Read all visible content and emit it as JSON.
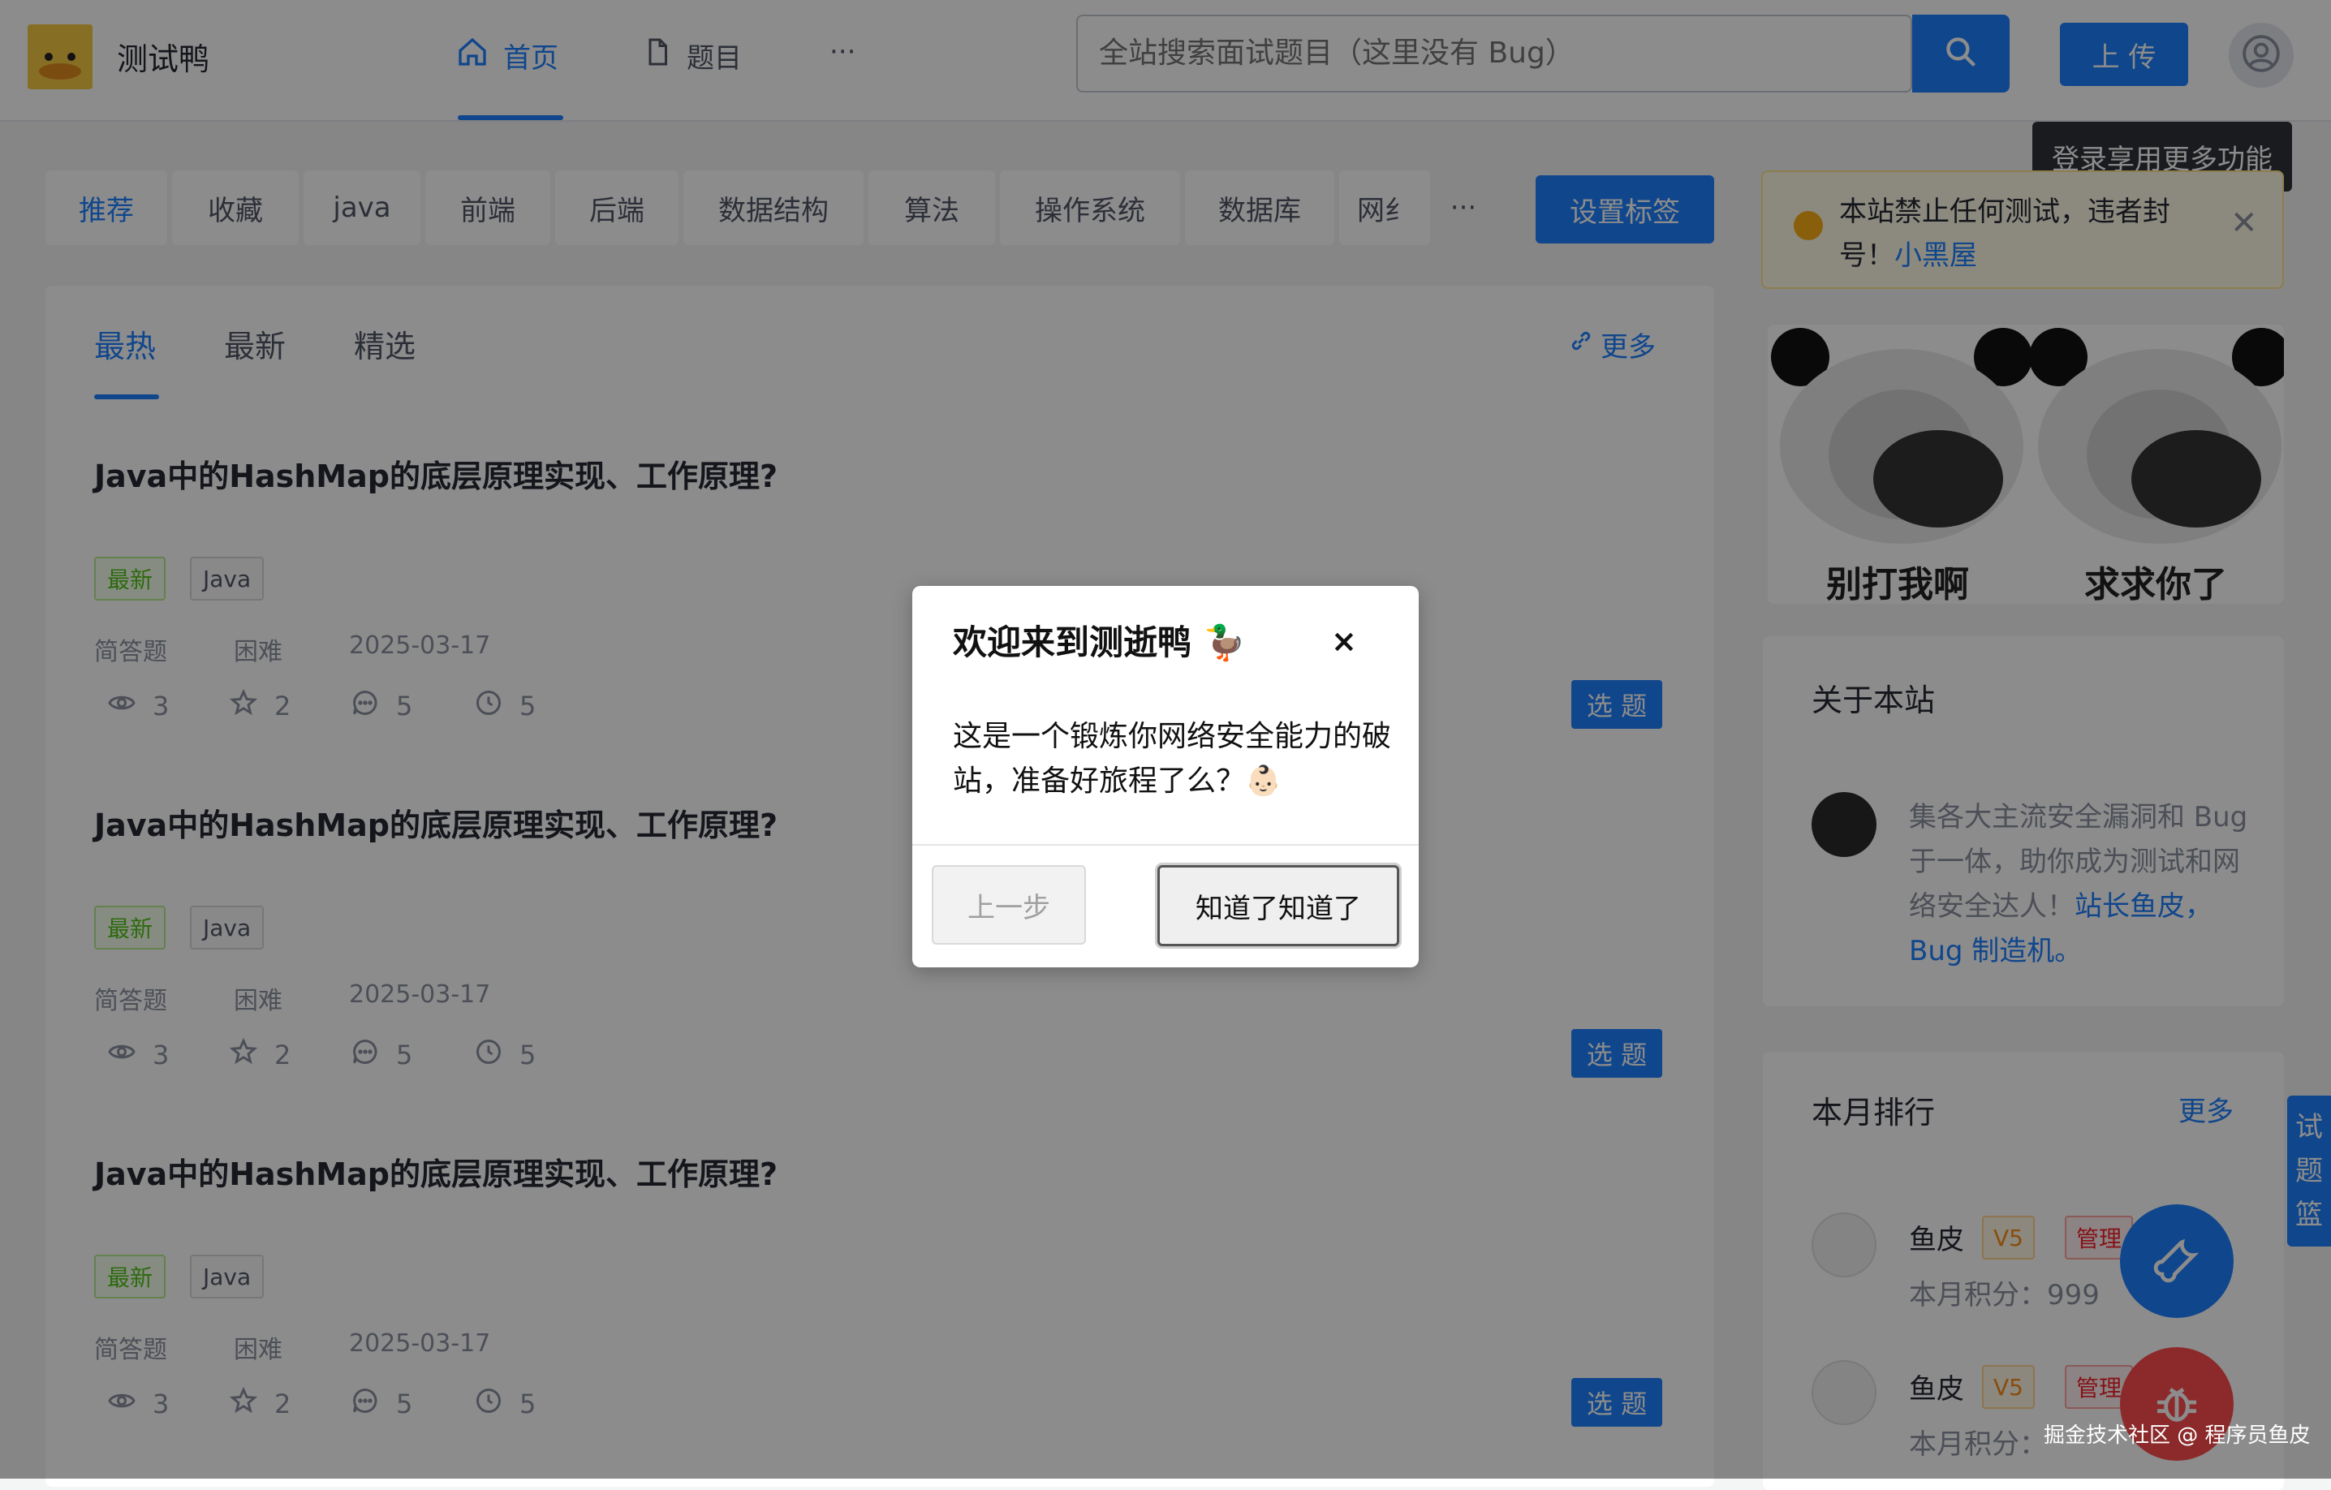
{
  "header": {
    "site_name": "测试鸭",
    "nav": [
      {
        "label": "首页",
        "icon": "home-icon"
      },
      {
        "label": "题目",
        "icon": "document-icon"
      },
      {
        "label": "···",
        "icon": "more-icon"
      }
    ],
    "search_placeholder": "全站搜索面试题目（这里没有 Bug）",
    "upload_label": "上 传",
    "tooltip": "登录享用更多功能"
  },
  "tags": {
    "items": [
      "推荐",
      "收藏",
      "java",
      "前端",
      "后端",
      "数据结构",
      "算法",
      "操作系统",
      "数据库",
      "网纟"
    ],
    "more": "···",
    "set_label": "设置标签"
  },
  "main": {
    "tabs": [
      "最热",
      "最新",
      "精选"
    ],
    "more_label": "更多",
    "questions": [
      {
        "title": "Java中的HashMap的底层原理实现、工作原理?",
        "badges": [
          "最新",
          "Java"
        ],
        "type": "简答题",
        "difficulty": "困难",
        "date": "2025-03-17",
        "views": "3",
        "stars": "2",
        "comments": "5",
        "time": "5",
        "pick": "选 题"
      },
      {
        "title": "Java中的HashMap的底层原理实现、工作原理?",
        "badges": [
          "最新",
          "Java"
        ],
        "type": "简答题",
        "difficulty": "困难",
        "date": "2025-03-17",
        "views": "3",
        "stars": "2",
        "comments": "5",
        "time": "5",
        "pick": "选 题"
      },
      {
        "title": "Java中的HashMap的底层原理实现、工作原理?",
        "badges": [
          "最新",
          "Java"
        ],
        "type": "简答题",
        "difficulty": "困难",
        "date": "2025-03-17",
        "views": "3",
        "stars": "2",
        "comments": "5",
        "time": "5",
        "pick": "选 题"
      }
    ]
  },
  "side": {
    "notice_text": "本站禁止任何测试，违者封号！",
    "notice_link": "小黑屋",
    "meme_left": "别打我啊",
    "meme_right": "求求你了",
    "about_title": "关于本站",
    "about_text": "集各大主流安全漏洞和 Bug 于一体，助你成为测试和网络安全达人！",
    "about_link": "站长鱼皮，Bug 制造机。",
    "rank_title": "本月排行",
    "rank_more": "更多",
    "ranks": [
      {
        "name": "鱼皮",
        "level": "V5",
        "role": "管理",
        "score": "本月积分：999"
      },
      {
        "name": "鱼皮",
        "level": "V5",
        "role": "管理",
        "score": "本月积分："
      }
    ],
    "side_tab": [
      "试",
      "题",
      "篮"
    ]
  },
  "modal": {
    "title": "欢迎来到测逝鸭 🦆",
    "close": "×",
    "body": "这是一个锻炼你网络安全能力的破站，准备好旅程了么？👶🏻",
    "prev_label": "上一步",
    "ok_label": "知道了知道了"
  },
  "watermark": "掘金技术社区 @ 程序员鱼皮",
  "colors": {
    "accent": "#1e80ff",
    "danger": "#ff4d4f",
    "warning": "#faad14"
  }
}
